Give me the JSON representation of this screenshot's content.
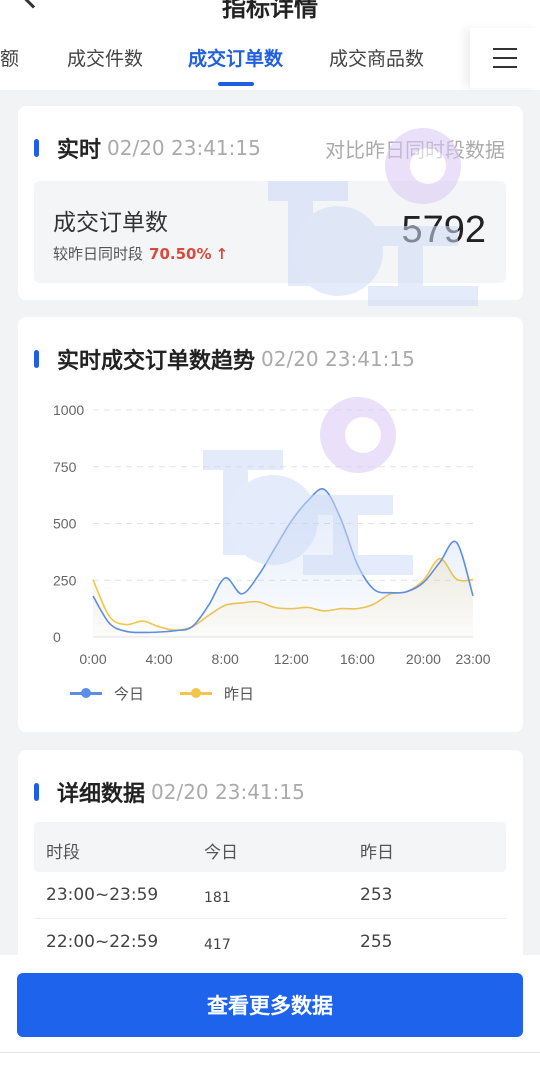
{
  "header": {
    "title": "指标详情"
  },
  "tabs": [
    {
      "label": "额"
    },
    {
      "label": "成交件数"
    },
    {
      "label": "成交订单数"
    },
    {
      "label": "成交商品数"
    }
  ],
  "realtime": {
    "title": "实时",
    "time": "02/20 23:41:15",
    "compare_link": "对比昨日同时段数据",
    "kpi_label": "成交订单数",
    "kpi_compare_label": "较昨日同时段",
    "kpi_change": "70.50%",
    "kpi_value": "5792"
  },
  "trend": {
    "title": "实时成交订单数趋势",
    "time": "02/20 23:41:15"
  },
  "chart_data": {
    "type": "line",
    "y_ticks": [
      "1000",
      "750",
      "500",
      "250",
      "0"
    ],
    "x_ticks": [
      "0:00",
      "4:00",
      "8:00",
      "12:00",
      "16:00",
      "20:00",
      "23:00"
    ],
    "ylim": [
      0,
      1000
    ],
    "grid": true,
    "legend_position": "bottom-left",
    "x": [
      0,
      1,
      2,
      3,
      4,
      5,
      6,
      7,
      8,
      9,
      10,
      11,
      12,
      13,
      14,
      15,
      16,
      17,
      18,
      19,
      20,
      21,
      22,
      23
    ],
    "series": [
      {
        "name": "今日",
        "color": "#5b8ee6",
        "values": [
          181,
          60,
          25,
          20,
          22,
          28,
          45,
          140,
          260,
          190,
          270,
          390,
          510,
          600,
          650,
          520,
          320,
          210,
          195,
          200,
          240,
          330,
          417,
          181
        ]
      },
      {
        "name": "昨日",
        "color": "#f4c54e",
        "values": [
          253,
          90,
          55,
          70,
          45,
          30,
          45,
          95,
          140,
          150,
          155,
          130,
          125,
          130,
          115,
          125,
          125,
          145,
          190,
          200,
          250,
          345,
          255,
          253
        ]
      }
    ]
  },
  "detail": {
    "title": "详细数据",
    "time": "02/20 23:41:15",
    "columns": [
      "时段",
      "今日",
      "昨日"
    ],
    "rows": [
      [
        "23:00~23:59",
        "181",
        "253"
      ],
      [
        "22:00~22:59",
        "417",
        "255"
      ]
    ]
  },
  "footer": {
    "cta_label": "查看更多数据"
  }
}
